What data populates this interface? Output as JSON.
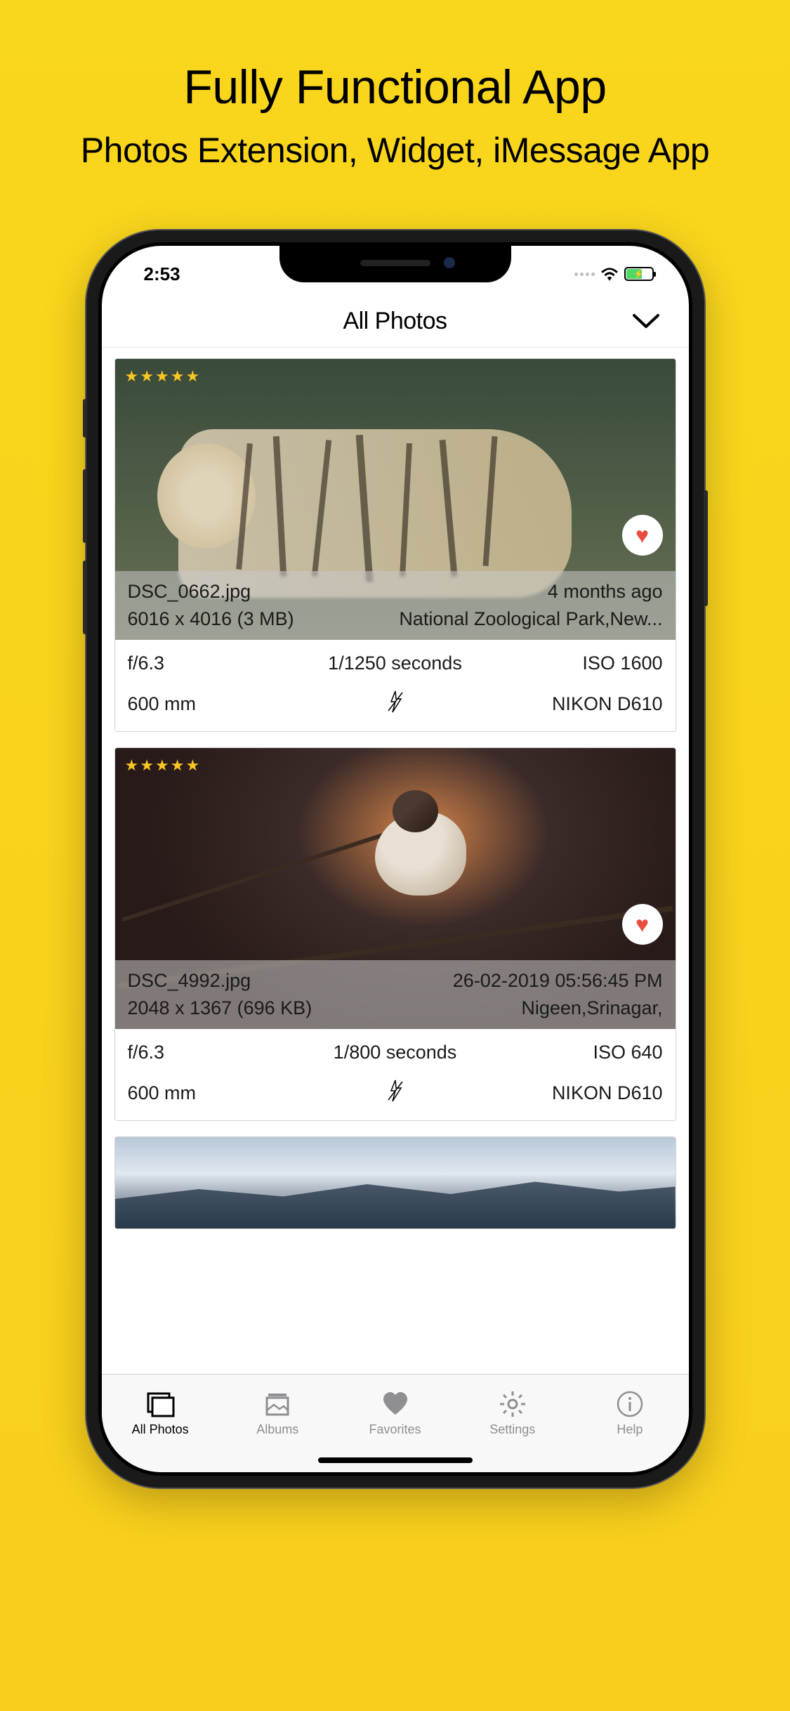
{
  "promo": {
    "title": "Fully Functional App",
    "subtitle": "Photos Extension, Widget, iMessage App"
  },
  "statusBar": {
    "time": "2:53"
  },
  "header": {
    "title": "All Photos"
  },
  "photos": [
    {
      "rating": 5,
      "favorite": true,
      "filename": "DSC_0662.jpg",
      "age": "4 months ago",
      "dimensions": "6016 x 4016 (3 MB)",
      "location": "National Zoological Park,New...",
      "aperture": "f/6.3",
      "shutter": "1/1250 seconds",
      "iso": "ISO 1600",
      "focalLength": "600 mm",
      "flashOff": true,
      "camera": "NIKON D610"
    },
    {
      "rating": 5,
      "favorite": true,
      "filename": "DSC_4992.jpg",
      "age": "26-02-2019 05:56:45 PM",
      "dimensions": "2048 x 1367 (696 KB)",
      "location": "Nigeen,Srinagar,",
      "aperture": "f/6.3",
      "shutter": "1/800 seconds",
      "iso": "ISO 640",
      "focalLength": "600 mm",
      "flashOff": true,
      "camera": "NIKON D610"
    }
  ],
  "tabs": {
    "allPhotos": "All Photos",
    "albums": "Albums",
    "favorites": "Favorites",
    "settings": "Settings",
    "help": "Help"
  }
}
